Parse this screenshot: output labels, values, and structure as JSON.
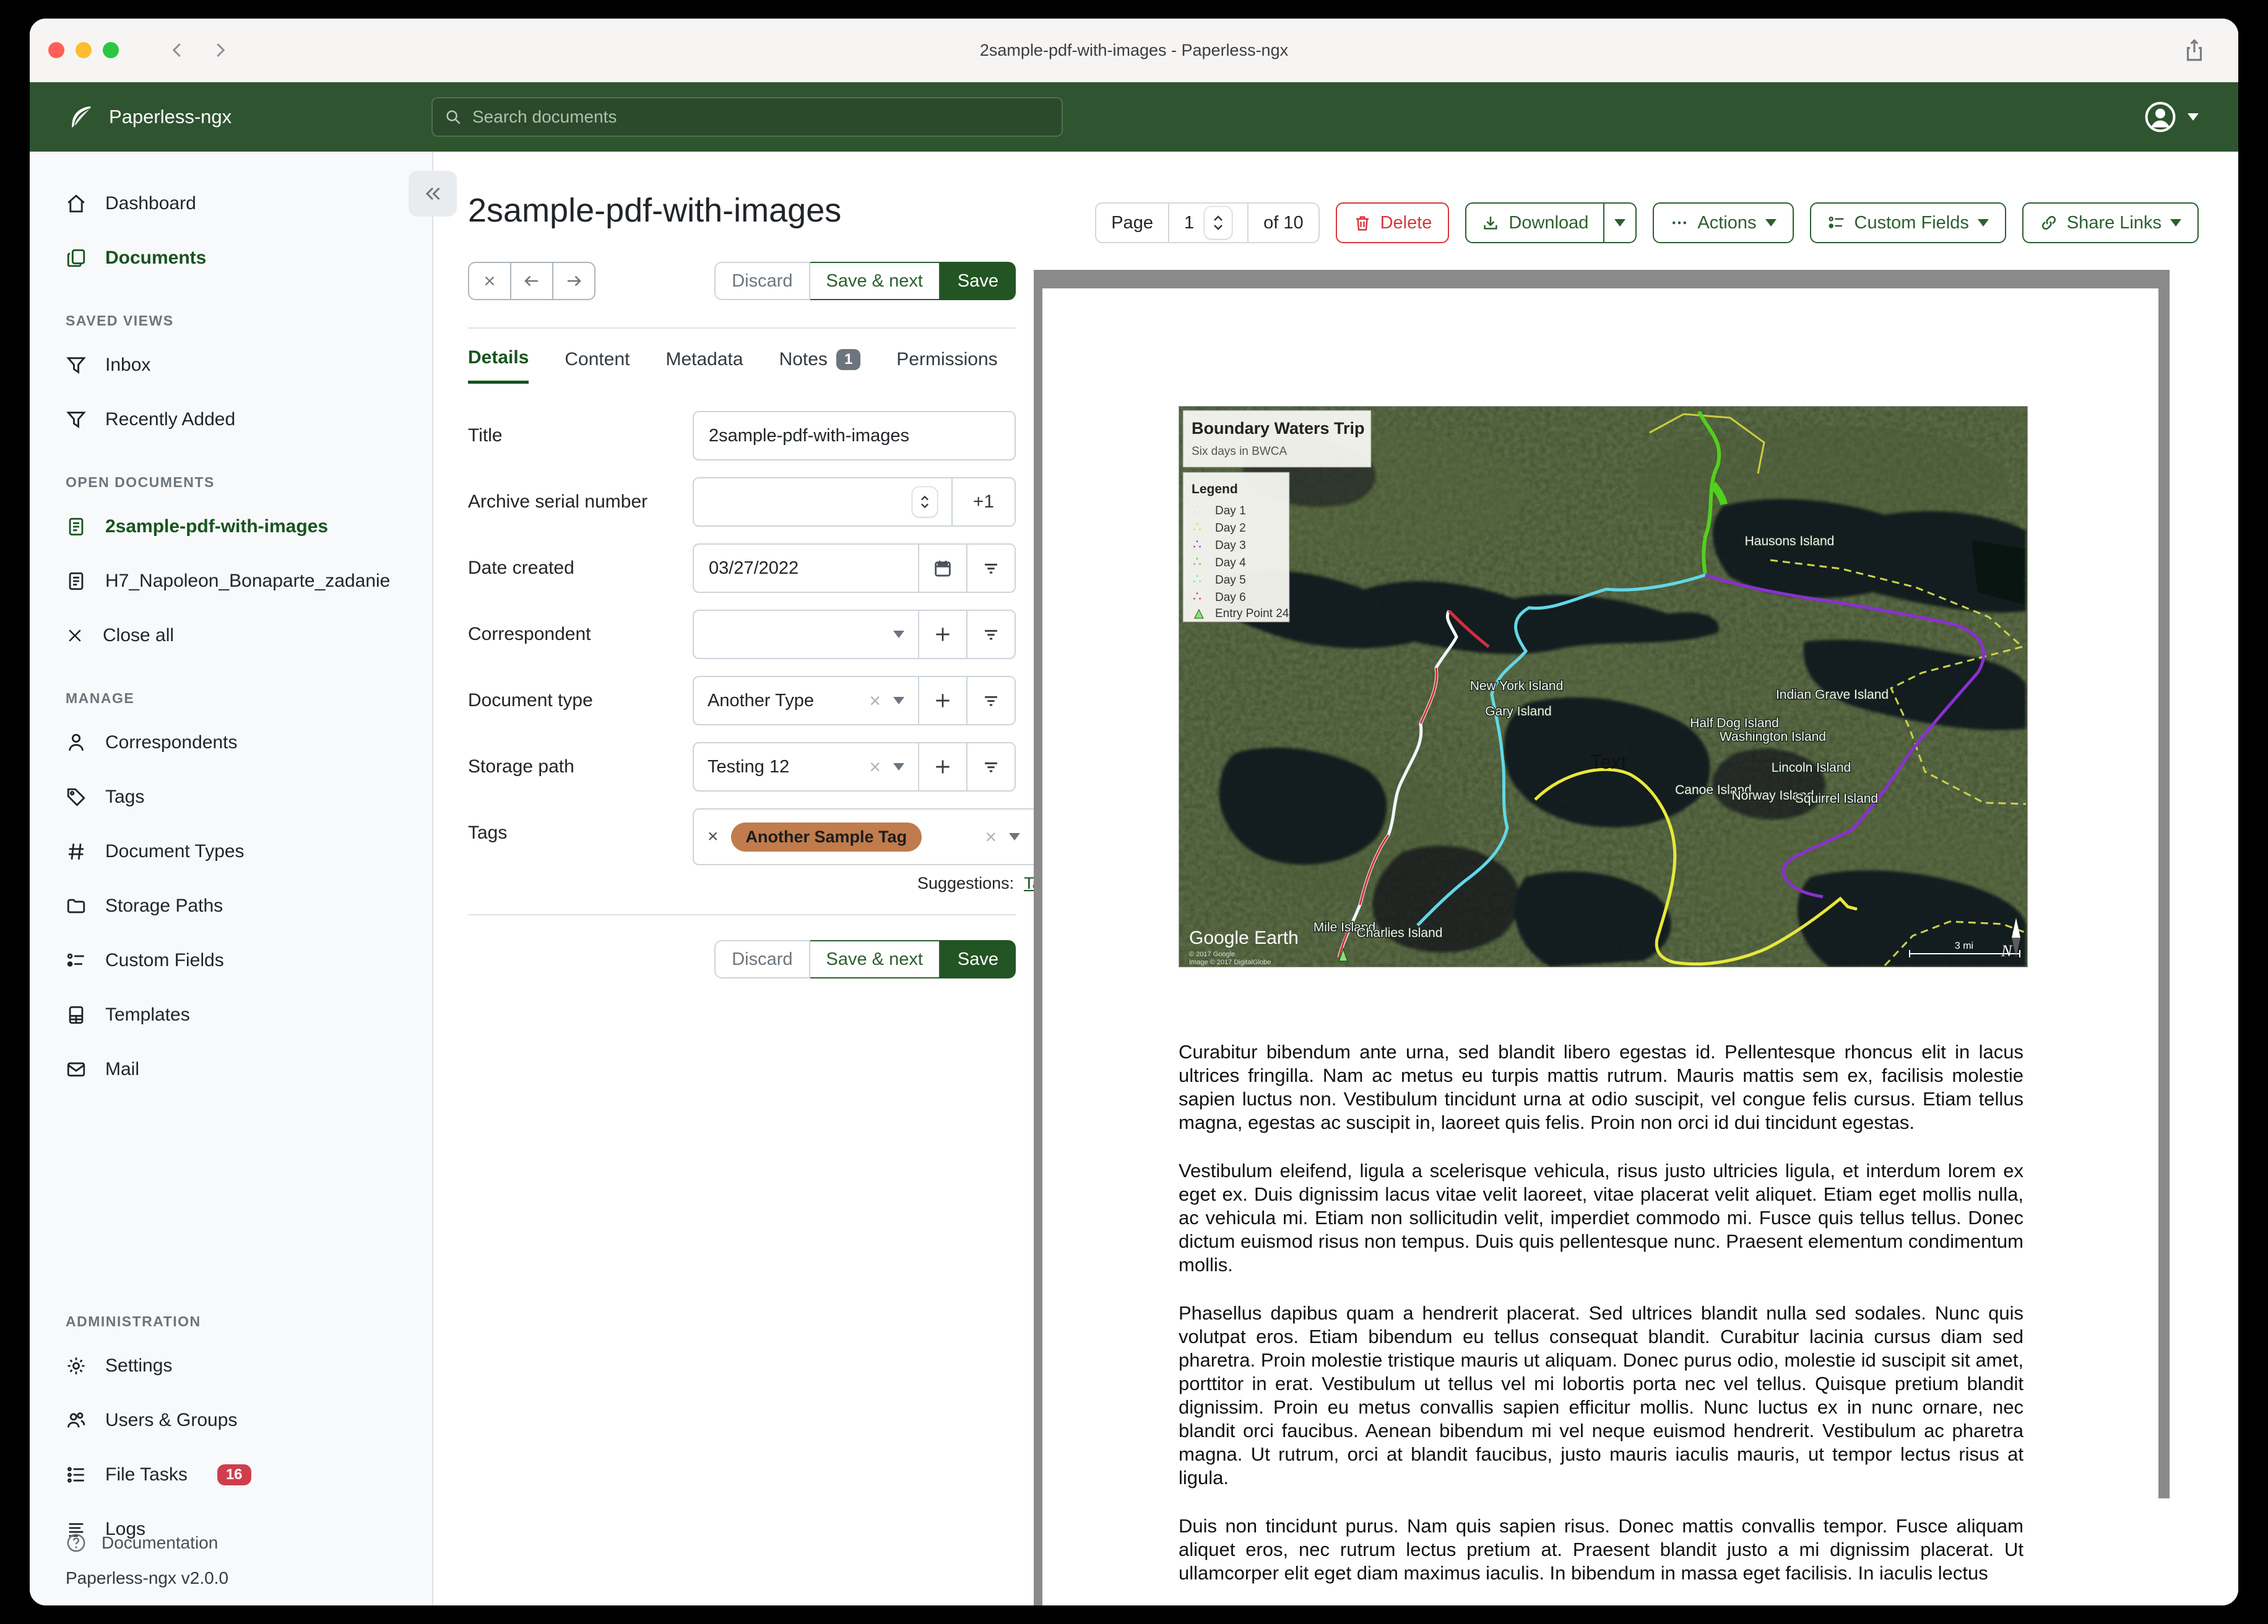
{
  "window": {
    "title": "2sample-pdf-with-images - Paperless-ngx"
  },
  "header": {
    "app_name": "Paperless-ngx",
    "search_placeholder": "Search documents"
  },
  "sidebar": {
    "dashboard": "Dashboard",
    "documents": "Documents",
    "saved_views_header": "SAVED VIEWS",
    "saved_views": [
      "Inbox",
      "Recently Added"
    ],
    "open_documents_header": "OPEN DOCUMENTS",
    "open_documents": [
      "2sample-pdf-with-images",
      "H7_Napoleon_Bonaparte_zadanie"
    ],
    "close_all": "Close all",
    "manage_header": "MANAGE",
    "manage": [
      "Correspondents",
      "Tags",
      "Document Types",
      "Storage Paths",
      "Custom Fields",
      "Templates",
      "Mail"
    ],
    "admin_header": "ADMINISTRATION",
    "admin": [
      "Settings",
      "Users & Groups",
      "File Tasks",
      "Logs"
    ],
    "file_tasks_badge": "16",
    "documentation": "Documentation",
    "version": "Paperless-ngx v2.0.0"
  },
  "toolbar": {
    "page_label": "Page",
    "page_value": "1",
    "page_of": "of 10",
    "delete": "Delete",
    "download": "Download",
    "actions": "Actions",
    "custom_fields": "Custom Fields",
    "share_links": "Share Links"
  },
  "document": {
    "title": "2sample-pdf-with-images",
    "discard": "Discard",
    "save_next": "Save & next",
    "save": "Save",
    "tabs": [
      {
        "label": "Details"
      },
      {
        "label": "Content"
      },
      {
        "label": "Metadata"
      },
      {
        "label": "Notes",
        "badge": "1"
      },
      {
        "label": "Permissions"
      }
    ],
    "fields": {
      "title_label": "Title",
      "title_value": "2sample-pdf-with-images",
      "asn_label": "Archive serial number",
      "asn_plus": "+1",
      "date_label": "Date created",
      "date_value": "03/27/2022",
      "correspondent_label": "Correspondent",
      "doctype_label": "Document type",
      "doctype_value": "Another Type",
      "storage_label": "Storage path",
      "storage_value": "Testing 12",
      "tags_label": "Tags",
      "tag_chip": "Another Sample Tag",
      "suggestions_label": "Suggestions:",
      "suggestion_link": "TagWithPartial"
    }
  },
  "preview": {
    "map": {
      "title": "Boundary Waters Trip",
      "subtitle": "Six days in BWCA",
      "legend_title": "Legend",
      "legend": [
        {
          "label": "Day 1",
          "color": "#cfe8ee"
        },
        {
          "label": "Day 2",
          "color": "#d8d840"
        },
        {
          "label": "Day 3",
          "color": "#8a30d0"
        },
        {
          "label": "Day 4",
          "color": "#52d01f"
        },
        {
          "label": "Day 5",
          "color": "#62d8e8"
        },
        {
          "label": "Day 6",
          "color": "#d03040"
        },
        {
          "label": "Entry Point 24",
          "color": "#86e27a"
        }
      ],
      "islands": [
        "Hausons Island",
        "New York Island",
        "Gary Island",
        "Indian Grave Island",
        "Half Dog Island",
        "Washington Island",
        "Lincoln Island",
        "Canoe Island",
        "Norway Island",
        "Squirrel Island",
        "Mile Island",
        "Charlies Island"
      ],
      "text_label": "Text",
      "credit": "Google Earth",
      "copyright1": "© 2017 Google",
      "copyright2": "Image © 2017 DigitalGlobe",
      "scale": "3 mi",
      "north": "N"
    },
    "paragraphs": [
      "Curabitur bibendum ante urna, sed blandit libero egestas id. Pellentesque rhoncus elit in lacus ultrices fringilla. Nam ac metus eu turpis mattis rutrum. Mauris mattis sem ex, facilisis molestie sapien luctus non. Vestibulum tincidunt urna at odio suscipit, vel congue felis cursus. Etiam tellus magna, egestas ac suscipit in, laoreet quis felis. Proin non orci id dui tincidunt egestas.",
      "Vestibulum eleifend, ligula a scelerisque vehicula, risus justo ultricies ligula, et interdum lorem ex eget ex. Duis dignissim lacus vitae velit laoreet, vitae placerat velit aliquet. Etiam eget mollis nulla, ac vehicula mi. Etiam non sollicitudin velit, imperdiet commodo mi. Fusce quis tellus tellus. Donec dictum euismod risus non tempus. Duis quis pellentesque nunc. Praesent elementum condimentum mollis.",
      "Phasellus dapibus quam a hendrerit placerat. Sed ultrices blandit nulla sed sodales. Nunc quis volutpat eros. Etiam bibendum eu tellus consequat blandit. Curabitur lacinia cursus diam sed pharetra. Proin molestie tristique mauris ut aliquam. Donec purus odio, molestie id suscipit sit amet, porttitor in erat. Vestibulum ut tellus vel mi lobortis porta nec vel tellus. Quisque pretium blandit dignissim. Proin eu metus convallis sapien efficitur mollis. Nunc luctus ex in nunc ornare, nec blandit orci faucibus. Aenean bibendum mi vel neque euismod hendrerit. Vestibulum ac pharetra magna. Ut rutrum, orci at blandit faucibus, justo mauris iaculis mauris, ut tempor lectus risus at ligula.",
      "Duis non tincidunt purus. Nam quis sapien risus. Donec mattis convallis tempor. Fusce aliquam aliquet eros, nec rutrum lectus pretium at. Praesent blandit justo a mi dignissim placerat. Ut ullamcorper elit eget diam maximus iaculis. In bibendum in massa eget facilisis. In iaculis lectus"
    ]
  }
}
